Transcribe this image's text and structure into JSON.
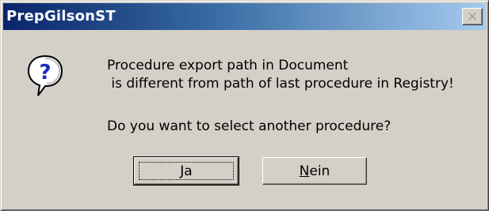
{
  "window": {
    "title": "PrepGilsonST",
    "close_glyph": "×"
  },
  "icon": {
    "name": "question-icon",
    "glyph": "?"
  },
  "message": {
    "line1": "Procedure export path in Document",
    "line2": " is different from path of last procedure in Registry!",
    "line3": "Do you want to select another procedure?"
  },
  "buttons": {
    "yes": {
      "mnemonic": "J",
      "rest": "a"
    },
    "no": {
      "mnemonic": "N",
      "rest": "ein"
    }
  },
  "colors": {
    "title_start": "#0a246a",
    "title_end": "#a6caf0",
    "dialog_bg": "#d4d0c8",
    "icon_blue": "#1c2bbd"
  }
}
